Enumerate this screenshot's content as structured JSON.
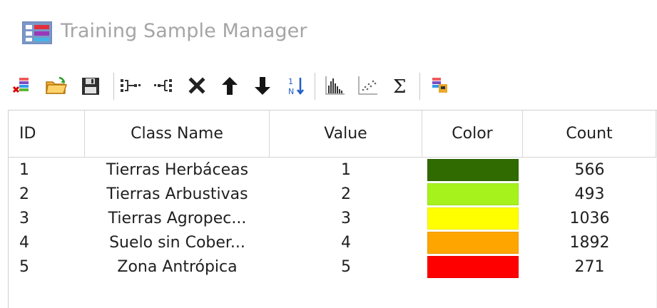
{
  "window": {
    "title": "Training Sample Manager"
  },
  "toolbar": {
    "icons": [
      "new-sample-icon",
      "open-folder-icon",
      "save-disk-icon",
      "merge-icon",
      "split-icon",
      "delete-icon",
      "move-up-icon",
      "move-down-icon",
      "sort-icon",
      "histogram-icon",
      "scatterplot-icon",
      "statistics-icon",
      "evaluate-icon"
    ]
  },
  "table": {
    "columns": [
      "ID",
      "Class Name",
      "Value",
      "Color",
      "Count"
    ],
    "rows": [
      {
        "id": "1",
        "class_name": "Tierras Herbáceas",
        "value": "1",
        "color": "#2f6b00",
        "count": "566"
      },
      {
        "id": "2",
        "class_name": "Tierras Arbustivas",
        "value": "2",
        "color": "#a6f21d",
        "count": "493"
      },
      {
        "id": "3",
        "class_name": "Tierras Agropec...",
        "value": "3",
        "color": "#ffff00",
        "count": "1036"
      },
      {
        "id": "4",
        "class_name": "Suelo sin Cober...",
        "value": "4",
        "color": "#ffa500",
        "count": "1892"
      },
      {
        "id": "5",
        "class_name": "Zona Antrópica",
        "value": "5",
        "color": "#ff0000",
        "count": "271"
      }
    ]
  },
  "colors": {
    "title_text": "#a5a5a5",
    "grid_line": "#d4d4d4"
  }
}
